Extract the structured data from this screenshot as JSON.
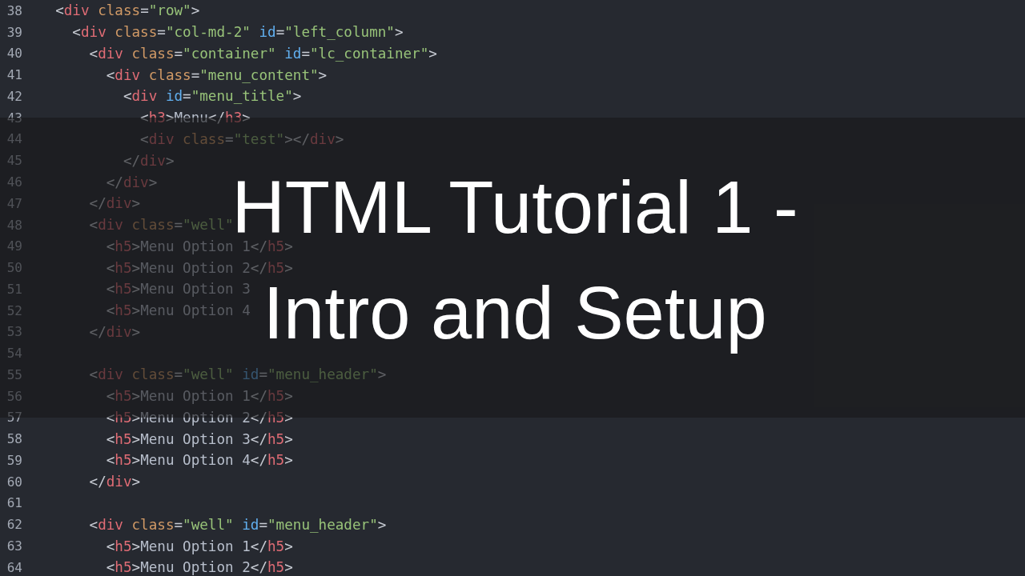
{
  "editor": {
    "lines": [
      {
        "number": "38",
        "tokens": [
          {
            "kind": "punct",
            "text": "  <"
          },
          {
            "kind": "tag",
            "text": "div"
          },
          {
            "kind": "attr",
            "text": " class"
          },
          {
            "kind": "punct",
            "text": "="
          },
          {
            "kind": "string",
            "text": "\"row\""
          },
          {
            "kind": "punct",
            "text": ">"
          }
        ]
      },
      {
        "number": "39",
        "tokens": [
          {
            "kind": "punct",
            "text": "    <"
          },
          {
            "kind": "tag",
            "text": "div"
          },
          {
            "kind": "attr",
            "text": " class"
          },
          {
            "kind": "punct",
            "text": "="
          },
          {
            "kind": "string",
            "text": "\"col-md-2\""
          },
          {
            "kind": "id",
            "text": " id"
          },
          {
            "kind": "punct",
            "text": "="
          },
          {
            "kind": "string",
            "text": "\"left_column\""
          },
          {
            "kind": "punct",
            "text": ">"
          }
        ]
      },
      {
        "number": "40",
        "tokens": [
          {
            "kind": "punct",
            "text": "      <"
          },
          {
            "kind": "tag",
            "text": "div"
          },
          {
            "kind": "attr",
            "text": " class"
          },
          {
            "kind": "punct",
            "text": "="
          },
          {
            "kind": "string",
            "text": "\"container\""
          },
          {
            "kind": "id",
            "text": " id"
          },
          {
            "kind": "punct",
            "text": "="
          },
          {
            "kind": "string",
            "text": "\"lc_container\""
          },
          {
            "kind": "punct",
            "text": ">"
          }
        ]
      },
      {
        "number": "41",
        "tokens": [
          {
            "kind": "punct",
            "text": "        <"
          },
          {
            "kind": "tag",
            "text": "div"
          },
          {
            "kind": "attr",
            "text": " class"
          },
          {
            "kind": "punct",
            "text": "="
          },
          {
            "kind": "string",
            "text": "\"menu_content\""
          },
          {
            "kind": "punct",
            "text": ">"
          }
        ]
      },
      {
        "number": "42",
        "tokens": [
          {
            "kind": "punct",
            "text": "          <"
          },
          {
            "kind": "tag",
            "text": "div"
          },
          {
            "kind": "id",
            "text": " id"
          },
          {
            "kind": "punct",
            "text": "="
          },
          {
            "kind": "string",
            "text": "\"menu_title\""
          },
          {
            "kind": "punct",
            "text": ">"
          }
        ]
      },
      {
        "number": "43",
        "tokens": [
          {
            "kind": "punct",
            "text": "            <"
          },
          {
            "kind": "tag",
            "text": "h3"
          },
          {
            "kind": "punct",
            "text": ">"
          },
          {
            "kind": "text",
            "text": "Menu"
          },
          {
            "kind": "punct",
            "text": "</"
          },
          {
            "kind": "tag",
            "text": "h3"
          },
          {
            "kind": "punct",
            "text": ">"
          }
        ]
      },
      {
        "number": "44",
        "tokens": [
          {
            "kind": "punct",
            "text": "            <"
          },
          {
            "kind": "tag",
            "text": "div"
          },
          {
            "kind": "attr",
            "text": " class"
          },
          {
            "kind": "punct",
            "text": "="
          },
          {
            "kind": "string",
            "text": "\"test\""
          },
          {
            "kind": "punct",
            "text": "></"
          },
          {
            "kind": "tag",
            "text": "div"
          },
          {
            "kind": "punct",
            "text": ">"
          }
        ]
      },
      {
        "number": "45",
        "tokens": [
          {
            "kind": "punct",
            "text": "          </"
          },
          {
            "kind": "tag",
            "text": "div"
          },
          {
            "kind": "punct",
            "text": ">"
          }
        ]
      },
      {
        "number": "46",
        "tokens": [
          {
            "kind": "punct",
            "text": "        </"
          },
          {
            "kind": "tag",
            "text": "div"
          },
          {
            "kind": "punct",
            "text": ">"
          }
        ]
      },
      {
        "number": "47",
        "tokens": [
          {
            "kind": "punct",
            "text": "      </"
          },
          {
            "kind": "tag",
            "text": "div"
          },
          {
            "kind": "punct",
            "text": ">"
          }
        ]
      },
      {
        "number": "48",
        "tokens": [
          {
            "kind": "punct",
            "text": "      <"
          },
          {
            "kind": "tag",
            "text": "div"
          },
          {
            "kind": "attr",
            "text": " class"
          },
          {
            "kind": "punct",
            "text": "="
          },
          {
            "kind": "string",
            "text": "\"well\""
          }
        ]
      },
      {
        "number": "49",
        "tokens": [
          {
            "kind": "punct",
            "text": "        <"
          },
          {
            "kind": "tag",
            "text": "h5"
          },
          {
            "kind": "punct",
            "text": ">"
          },
          {
            "kind": "text",
            "text": "Menu Option 1"
          },
          {
            "kind": "punct",
            "text": "</"
          },
          {
            "kind": "tag",
            "text": "h5"
          },
          {
            "kind": "punct",
            "text": ">"
          }
        ]
      },
      {
        "number": "50",
        "tokens": [
          {
            "kind": "punct",
            "text": "        <"
          },
          {
            "kind": "tag",
            "text": "h5"
          },
          {
            "kind": "punct",
            "text": ">"
          },
          {
            "kind": "text",
            "text": "Menu Option 2"
          },
          {
            "kind": "punct",
            "text": "</"
          },
          {
            "kind": "tag",
            "text": "h5"
          },
          {
            "kind": "punct",
            "text": ">"
          }
        ]
      },
      {
        "number": "51",
        "tokens": [
          {
            "kind": "punct",
            "text": "        <"
          },
          {
            "kind": "tag",
            "text": "h5"
          },
          {
            "kind": "punct",
            "text": ">"
          },
          {
            "kind": "text",
            "text": "Menu Option 3"
          }
        ]
      },
      {
        "number": "52",
        "tokens": [
          {
            "kind": "punct",
            "text": "        <"
          },
          {
            "kind": "tag",
            "text": "h5"
          },
          {
            "kind": "punct",
            "text": ">"
          },
          {
            "kind": "text",
            "text": "Menu Option 4"
          }
        ]
      },
      {
        "number": "53",
        "tokens": [
          {
            "kind": "punct",
            "text": "      </"
          },
          {
            "kind": "tag",
            "text": "div"
          },
          {
            "kind": "punct",
            "text": ">"
          }
        ]
      },
      {
        "number": "54"
      },
      {
        "number": "55",
        "tokens": [
          {
            "kind": "punct",
            "text": "      <"
          },
          {
            "kind": "tag",
            "text": "div"
          },
          {
            "kind": "attr",
            "text": " class"
          },
          {
            "kind": "punct",
            "text": "="
          },
          {
            "kind": "string",
            "text": "\"well\""
          },
          {
            "kind": "id",
            "text": " id"
          },
          {
            "kind": "punct",
            "text": "="
          },
          {
            "kind": "string",
            "text": "\"menu_header\""
          },
          {
            "kind": "punct",
            "text": ">"
          }
        ]
      },
      {
        "number": "56",
        "tokens": [
          {
            "kind": "punct",
            "text": "        <"
          },
          {
            "kind": "tag",
            "text": "h5"
          },
          {
            "kind": "punct",
            "text": ">"
          },
          {
            "kind": "text",
            "text": "Menu Option 1"
          },
          {
            "kind": "punct",
            "text": "</"
          },
          {
            "kind": "tag",
            "text": "h5"
          },
          {
            "kind": "punct",
            "text": ">"
          }
        ]
      },
      {
        "number": "57",
        "tokens": [
          {
            "kind": "punct",
            "text": "        <"
          },
          {
            "kind": "tag",
            "text": "h5"
          },
          {
            "kind": "punct",
            "text": ">"
          },
          {
            "kind": "text",
            "text": "Menu Option 2"
          },
          {
            "kind": "punct",
            "text": "</"
          },
          {
            "kind": "tag",
            "text": "h5"
          },
          {
            "kind": "punct",
            "text": ">"
          }
        ]
      },
      {
        "number": "58",
        "tokens": [
          {
            "kind": "punct",
            "text": "        <"
          },
          {
            "kind": "tag",
            "text": "h5"
          },
          {
            "kind": "punct",
            "text": ">"
          },
          {
            "kind": "text",
            "text": "Menu Option 3"
          },
          {
            "kind": "punct",
            "text": "</"
          },
          {
            "kind": "tag",
            "text": "h5"
          },
          {
            "kind": "punct",
            "text": ">"
          }
        ]
      },
      {
        "number": "59",
        "tokens": [
          {
            "kind": "punct",
            "text": "        <"
          },
          {
            "kind": "tag",
            "text": "h5"
          },
          {
            "kind": "punct",
            "text": ">"
          },
          {
            "kind": "text",
            "text": "Menu Option 4"
          },
          {
            "kind": "punct",
            "text": "</"
          },
          {
            "kind": "tag",
            "text": "h5"
          },
          {
            "kind": "punct",
            "text": ">"
          }
        ]
      },
      {
        "number": "60",
        "tokens": [
          {
            "kind": "punct",
            "text": "      </"
          },
          {
            "kind": "tag",
            "text": "div"
          },
          {
            "kind": "punct",
            "text": ">"
          }
        ]
      },
      {
        "number": "61"
      },
      {
        "number": "62",
        "tokens": [
          {
            "kind": "punct",
            "text": "      <"
          },
          {
            "kind": "tag",
            "text": "div"
          },
          {
            "kind": "attr",
            "text": " class"
          },
          {
            "kind": "punct",
            "text": "="
          },
          {
            "kind": "string",
            "text": "\"well\""
          },
          {
            "kind": "id",
            "text": " id"
          },
          {
            "kind": "punct",
            "text": "="
          },
          {
            "kind": "string",
            "text": "\"menu_header\""
          },
          {
            "kind": "punct",
            "text": ">"
          }
        ]
      },
      {
        "number": "63",
        "tokens": [
          {
            "kind": "punct",
            "text": "        <"
          },
          {
            "kind": "tag",
            "text": "h5"
          },
          {
            "kind": "punct",
            "text": ">"
          },
          {
            "kind": "text",
            "text": "Menu Option 1"
          },
          {
            "kind": "punct",
            "text": "</"
          },
          {
            "kind": "tag",
            "text": "h5"
          },
          {
            "kind": "punct",
            "text": ">"
          }
        ]
      },
      {
        "number": "64",
        "tokens": [
          {
            "kind": "punct",
            "text": "        <"
          },
          {
            "kind": "tag",
            "text": "h5"
          },
          {
            "kind": "punct",
            "text": ">"
          },
          {
            "kind": "text",
            "text": "Menu Option 2"
          },
          {
            "kind": "punct",
            "text": "</"
          },
          {
            "kind": "tag",
            "text": "h5"
          },
          {
            "kind": "punct",
            "text": ">"
          }
        ]
      }
    ]
  },
  "banner": {
    "title_lines": [
      "HTML Tutorial 1 -",
      "Intro and Setup"
    ]
  }
}
